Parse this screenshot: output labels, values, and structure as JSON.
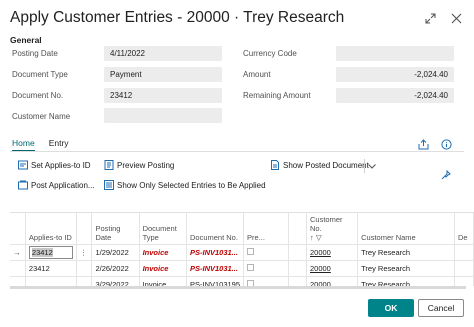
{
  "window": {
    "title": "Apply Customer Entries - 20000 · Trey Research",
    "icons": [
      "expand-icon",
      "close-icon"
    ]
  },
  "general": {
    "section_label": "General",
    "posting_date": {
      "label": "Posting Date",
      "value": "4/11/2022"
    },
    "document_type": {
      "label": "Document Type",
      "value": "Payment"
    },
    "document_no": {
      "label": "Document No.",
      "value": "23412"
    },
    "customer_name": {
      "label": "Customer Name",
      "value": ""
    },
    "currency_code": {
      "label": "Currency Code",
      "value": ""
    },
    "amount": {
      "label": "Amount",
      "value": "-2,024.40"
    },
    "remaining_amount": {
      "label": "Remaining Amount",
      "value": "-2,024.40"
    }
  },
  "tabs": [
    {
      "label": "Home",
      "active": true
    },
    {
      "label": "Entry",
      "active": false
    }
  ],
  "actions": {
    "set_applies_to_id": "Set Applies-to ID",
    "preview_posting": "Preview Posting",
    "show_posted_document": "Show Posted Document",
    "post_application": "Post Application...",
    "show_only_selected": "Show Only Selected Entries to Be Applied"
  },
  "table": {
    "headers": {
      "applies_to_id": "Applies-to ID",
      "posting_date": "Posting Date",
      "document_type": "Document Type",
      "document_no": "Document No.",
      "pre": "Pre...",
      "customer_no": "Customer No.",
      "customer_name": "Customer Name",
      "de": "De"
    },
    "rows": [
      {
        "applies_to_id": "23412",
        "posting_date": "1/29/2022",
        "document_type": "Invoice",
        "document_no": "PS-INV1031...",
        "customer_no": "20000",
        "customer_name": "Trey Research",
        "highlight": true,
        "current": true
      },
      {
        "applies_to_id": "23412",
        "posting_date": "2/26/2022",
        "document_type": "Invoice",
        "document_no": "PS-INV1031...",
        "customer_no": "20000",
        "customer_name": "Trey Research",
        "highlight": true,
        "current": false
      },
      {
        "applies_to_id": "",
        "posting_date": "3/29/2022",
        "document_type": "Invoice",
        "document_no": "PS-INV103195",
        "customer_no": "20000",
        "customer_name": "Trey Research",
        "highlight": false,
        "current": false
      }
    ]
  },
  "footer": {
    "ok_label": "OK",
    "cancel_label": "Cancel"
  },
  "colors": {
    "accent": "#008489",
    "link_blue": "#1f6db1",
    "highlight_red": "#c00000",
    "field_bg": "#ececec"
  }
}
